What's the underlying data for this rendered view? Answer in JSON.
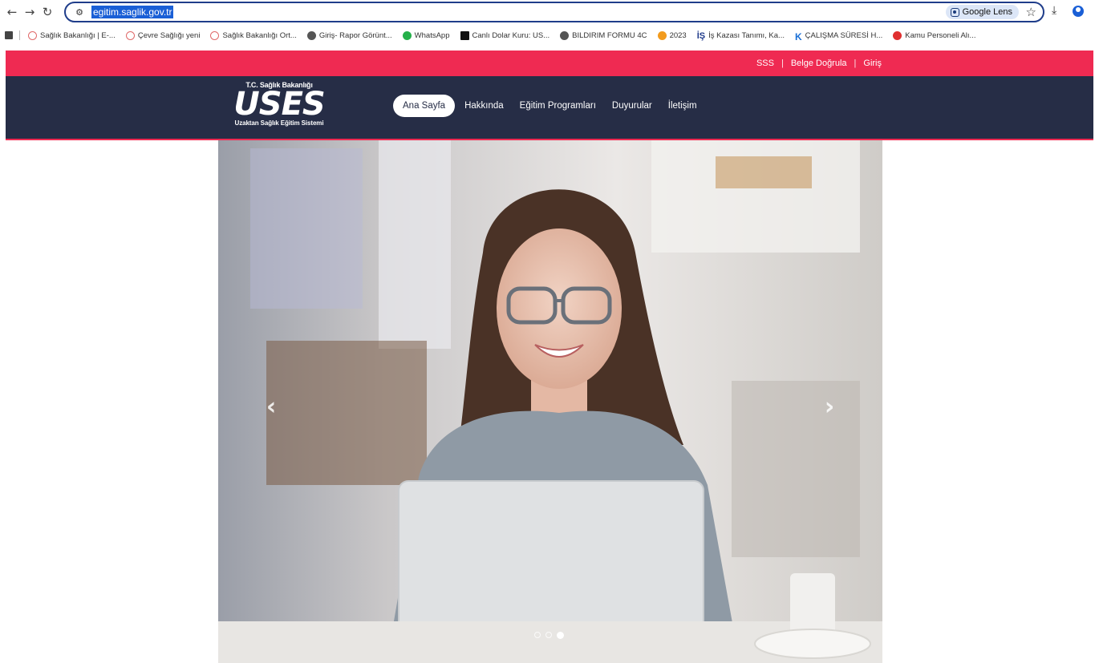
{
  "browser": {
    "url": "egitim.saglik.gov.tr",
    "lens_label": "Google Lens",
    "bookmarks": [
      {
        "label": "Sağlık Bakanlığı | E-...",
        "icon": "saglik-bakanligi-icon"
      },
      {
        "label": "Çevre Sağlığı yeni",
        "icon": "saglik-bakanligi-icon"
      },
      {
        "label": "Sağlık Bakanlığı Ort...",
        "icon": "saglik-bakanligi-icon"
      },
      {
        "label": "Giriş- Rapor Görünt...",
        "icon": "globe-icon"
      },
      {
        "label": "WhatsApp",
        "icon": "whatsapp-icon"
      },
      {
        "label": "Canlı Dolar Kuru: US...",
        "icon": "p-icon"
      },
      {
        "label": "BILDIRIM FORMU 4C",
        "icon": "globe-icon"
      },
      {
        "label": "2023",
        "icon": "orange-icon"
      },
      {
        "label": "İş Kazası Tanımı, Ka...",
        "icon": "is-icon"
      },
      {
        "label": "ÇALIŞMA SÜRESİ H...",
        "icon": "k-icon"
      },
      {
        "label": "Kamu Personeli Alı...",
        "icon": "kamu-icon"
      }
    ]
  },
  "topbar": {
    "links": [
      "SSS",
      "Belge Doğrula",
      "Giriş"
    ],
    "separator": "|"
  },
  "logo": {
    "top": "T.C. Sağlık Bakanlığı",
    "main": "USES",
    "sub": "Uzaktan Sağlık Eğitim Sistemi"
  },
  "nav": {
    "items": [
      "Ana Sayfa",
      "Hakkında",
      "Eğitim Programları",
      "Duyurular",
      "İletişim"
    ],
    "active": "Ana Sayfa"
  },
  "carousel": {
    "prev_glyph": "‹",
    "next_glyph": "›",
    "slide_count": 3,
    "active_slide": 3,
    "image_description": "woman-with-glasses-smiling-at-laptop"
  },
  "colors": {
    "accent_red": "#ef2a52",
    "navbar_navy": "#262d46"
  }
}
